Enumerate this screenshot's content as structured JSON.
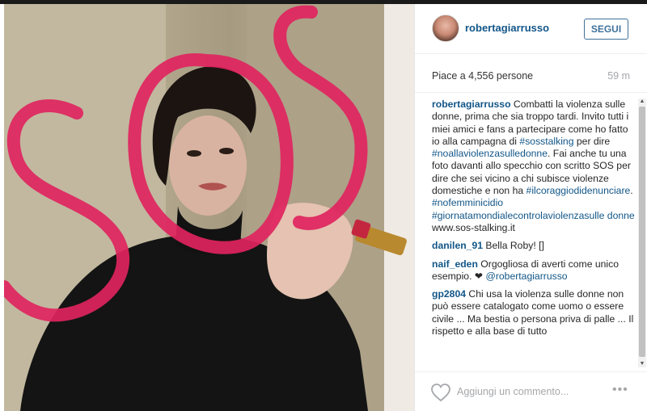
{
  "post": {
    "username": "robertagiarrusso",
    "follow_label": "SEGUI",
    "likes": "Piace a 4,556 persone",
    "time": "59 m"
  },
  "caption": {
    "user": "robertagiarrusso",
    "text1": "Combatti la violenza sulle donne, prima che sia troppo tardi. Invito tutti i miei amici e fans a partecipare come ho fatto io alla campagna di",
    "tag1": "#sosstalking",
    "text2": "per dire",
    "tag2": "#noallaviolenzasulledonne",
    "text3": ". Fai anche tu una foto davanti allo specchio con scritto SOS per dire che sei vicino a chi subisce violenze domestiche e non ha",
    "tag3": "#ilcoraggiodidenunciare",
    "text4": ".",
    "tag4": "#nofemminicidio",
    "tag5": "#giornatamondialecontrolaviolenzasulle donne",
    "link": "www.sos-stalking.it"
  },
  "comments": [
    {
      "user": "danilen_91",
      "text": "Bella Roby! []"
    },
    {
      "user": "naif_eden",
      "text": "Orgogliosa di averti come unico esempio. ❤",
      "mention": "@robertagiarrusso"
    },
    {
      "user": "gp2804",
      "text": "Chi usa la violenza sulle donne non può essere catalogato come uomo o essere civile ... Ma bestia o persona priva di palle ... Il rispetto e alla base di tutto"
    }
  ],
  "footer": {
    "comment_placeholder": "Aggiungi un commento...",
    "more_label": "•••"
  },
  "icons": {
    "heart": "heart-icon",
    "more": "more-options-icon"
  },
  "colors": {
    "link_blue": "#125688",
    "follow_blue": "#3f729b",
    "lipstick_red": "#e0245e"
  }
}
